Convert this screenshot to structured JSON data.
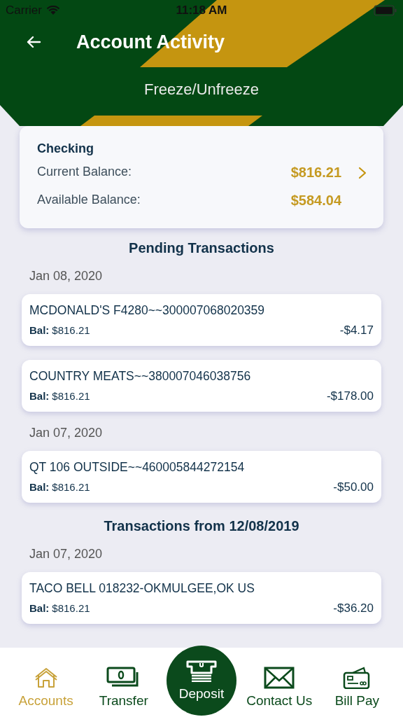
{
  "status_bar": {
    "carrier": "Carrier",
    "time": "11:18 AM"
  },
  "header": {
    "title": "Account Activity",
    "action": "Freeze/Unfreeze"
  },
  "account": {
    "name": "Checking",
    "rows": [
      {
        "label": "Current Balance:",
        "value": "$816.21"
      },
      {
        "label": "Available Balance:",
        "value": "$584.04"
      }
    ]
  },
  "sections": [
    {
      "title": "Pending Transactions",
      "groups": [
        {
          "date": "Jan 08, 2020",
          "transactions": [
            {
              "description": "MCDONALD'S F4280~~300007068020359",
              "bal_label": "Bal:",
              "balance": "$816.21",
              "amount": "-$4.17"
            },
            {
              "description": "COUNTRY MEATS~~380007046038756",
              "bal_label": "Bal:",
              "balance": "$816.21",
              "amount": "-$178.00"
            }
          ]
        },
        {
          "date": "Jan 07, 2020",
          "transactions": [
            {
              "description": "QT 106 OUTSIDE~~460005844272154",
              "bal_label": "Bal:",
              "balance": "$816.21",
              "amount": "-$50.00"
            }
          ]
        }
      ]
    },
    {
      "title": "Transactions from 12/08/2019",
      "groups": [
        {
          "date": "Jan 07, 2020",
          "transactions": [
            {
              "description": "TACO BELL 018232-OKMULGEE,OK US",
              "bal_label": "Bal:",
              "balance": "$816.21",
              "amount": "-$36.20"
            }
          ]
        }
      ]
    }
  ],
  "tab_bar": [
    {
      "label": "Accounts",
      "kind": "home",
      "selected": true
    },
    {
      "label": "Transfer",
      "kind": "cash",
      "selected": false
    },
    {
      "label": "Deposit",
      "kind": "atm",
      "selected": false
    },
    {
      "label": "Contact Us",
      "kind": "mail",
      "selected": false
    },
    {
      "label": "Bill Pay",
      "kind": "card",
      "selected": false
    }
  ]
}
